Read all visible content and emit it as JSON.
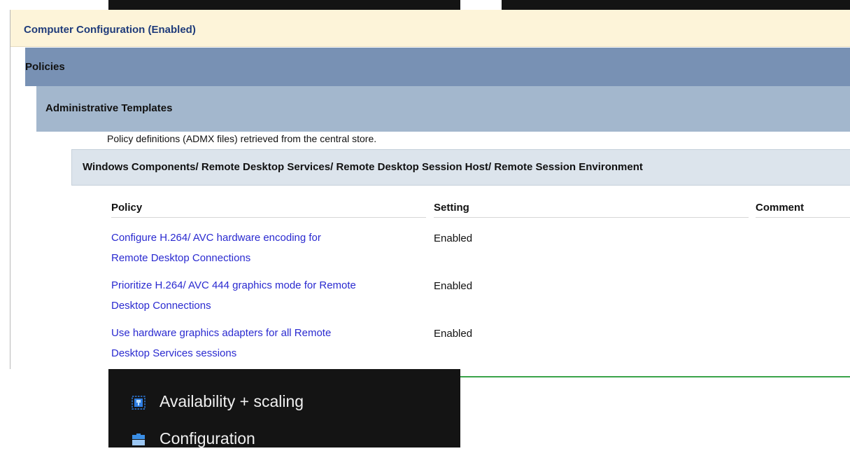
{
  "report": {
    "computer_configuration": "Computer Configuration (Enabled)",
    "policies": "Policies",
    "administrative_templates": "Administrative Templates",
    "admx_note": "Policy definitions (ADMX files) retrieved from the central store.",
    "section_path": "Windows Components/ Remote Desktop Services/ Remote Desktop Session Host/ Remote Session Environment",
    "columns": {
      "policy": "Policy",
      "setting": "Setting",
      "comment": "Comment"
    },
    "rows": [
      {
        "policy_line1": "Configure H.264/ AVC hardware encoding for",
        "policy_line2": "Remote Desktop Connections",
        "setting": "Enabled"
      },
      {
        "policy_line1": "Prioritize H.264/ AVC 444 graphics mode for Remote",
        "policy_line2": "Desktop Connections",
        "setting": "Enabled"
      },
      {
        "policy_line1": "Use hardware graphics adapters for all Remote",
        "policy_line2": "Desktop Services sessions",
        "setting": "Enabled"
      }
    ]
  },
  "nav": {
    "items": [
      {
        "label": "Availability + scaling",
        "icon": "availability-scaling-icon"
      },
      {
        "label": "Configuration",
        "icon": "configuration-icon"
      }
    ]
  },
  "colors": {
    "computer_bar": "#fdf4d9",
    "policies_bar": "#7891b4",
    "admin_bar": "#a3b7cd",
    "section_bar": "#dce4ec",
    "link": "#2a2ad0",
    "nav_bg": "#141414",
    "accent_line": "#3aa44a"
  }
}
